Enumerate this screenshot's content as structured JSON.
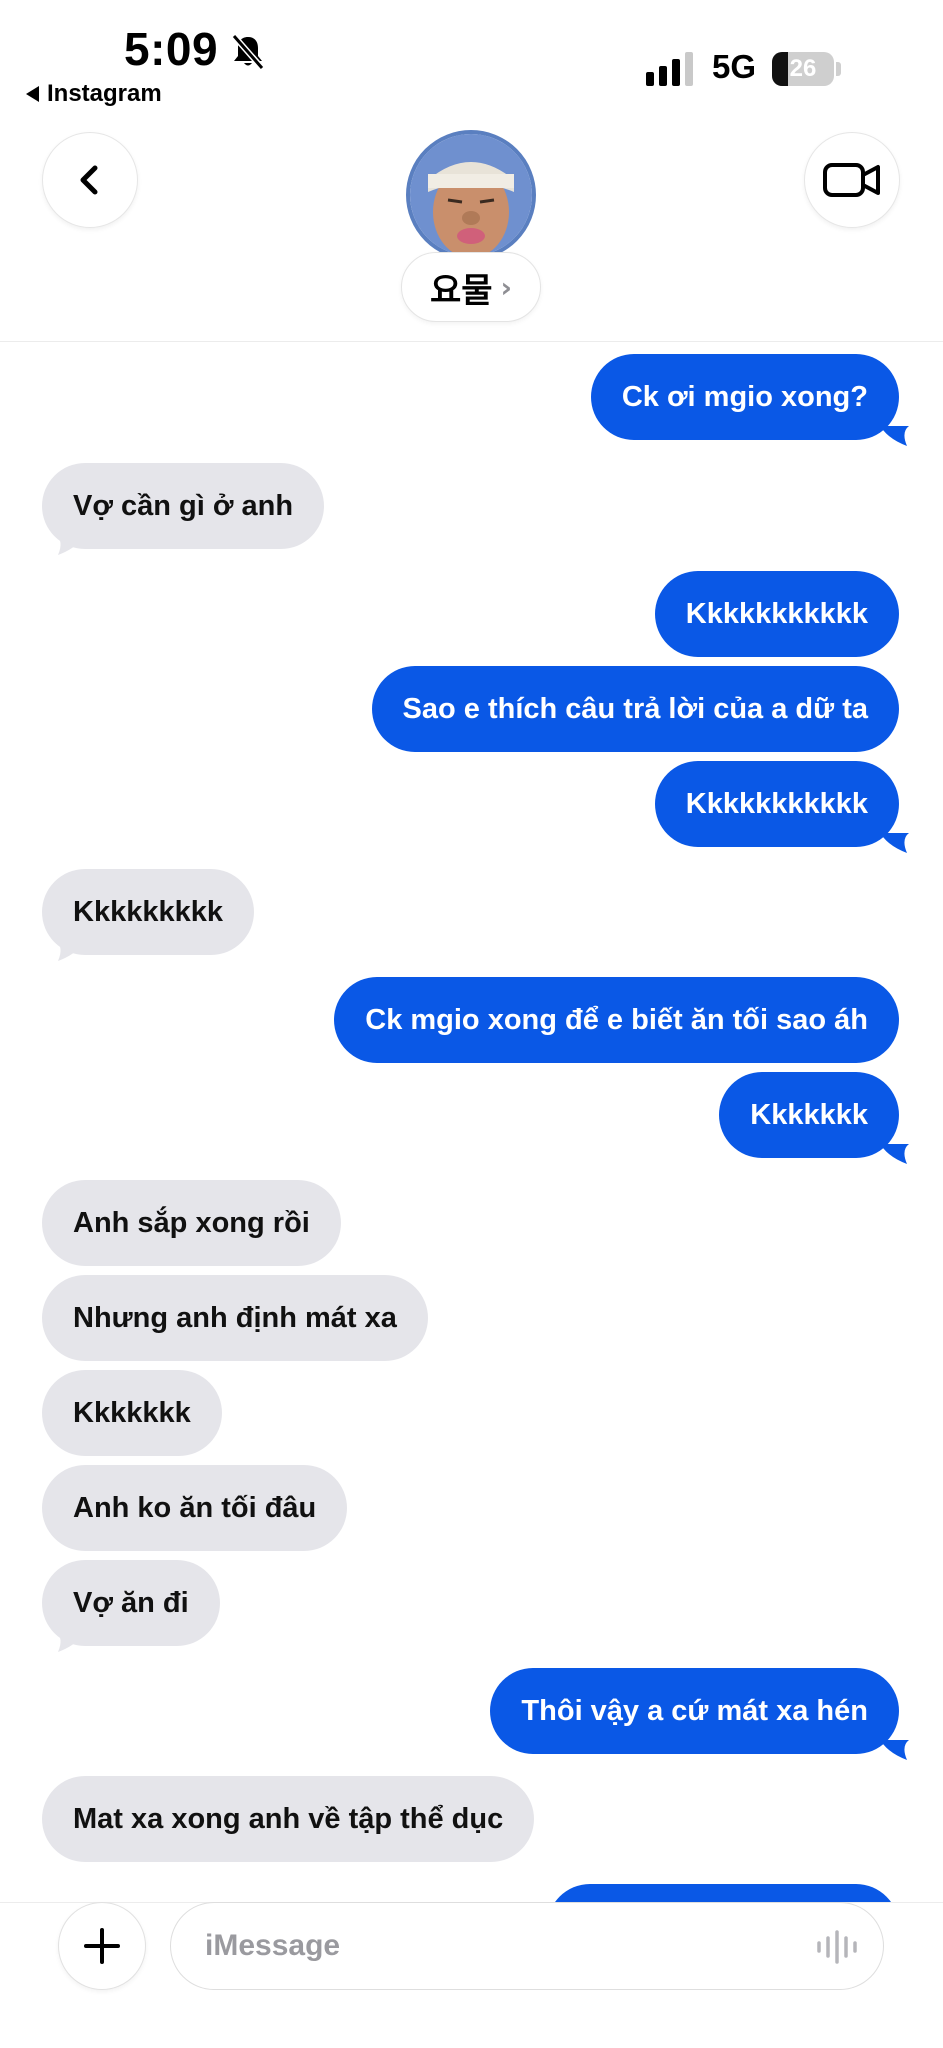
{
  "status_bar": {
    "time": "5:09",
    "back_app": "Instagram",
    "network": "5G",
    "battery_level": "26",
    "battery_fraction": 0.26,
    "signal_bars_filled": 3
  },
  "header": {
    "contact_name": "요물",
    "chevron": "›"
  },
  "messages": [
    {
      "side": "out",
      "text": "Ck ơi mgio xong?",
      "tail": true
    },
    {
      "side": "in",
      "text": "Vợ cần gì ở anh",
      "tail": true
    },
    {
      "side": "out",
      "text": "Kkkkkkkkkkk",
      "tail": false
    },
    {
      "side": "out",
      "text": "Sao e thích câu trả lời của a dữ ta",
      "tail": false
    },
    {
      "side": "out",
      "text": "Kkkkkkkkkkk",
      "tail": true
    },
    {
      "side": "in",
      "text": "Kkkkkkkkk",
      "tail": true
    },
    {
      "side": "out",
      "text": "Ck mgio xong để e biết ăn tối sao áh",
      "tail": false
    },
    {
      "side": "out",
      "text": "Kkkkkkk",
      "tail": true
    },
    {
      "side": "in",
      "text": "Anh sắp xong rồi",
      "tail": false
    },
    {
      "side": "in",
      "text": "Nhưng anh định mát xa",
      "tail": false
    },
    {
      "side": "in",
      "text": "Kkkkkkk",
      "tail": false
    },
    {
      "side": "in",
      "text": "Anh ko ăn tối đâu",
      "tail": false
    },
    {
      "side": "in",
      "text": "Vợ ăn đi",
      "tail": true
    },
    {
      "side": "out",
      "text": "Thôi vậy a cứ mát xa hén",
      "tail": true
    },
    {
      "side": "in",
      "text": "Mat xa xong anh về tập thể dục",
      "tail": false
    },
    {
      "side": "out",
      "text": "",
      "tail": false
    }
  ],
  "composer": {
    "placeholder": "iMessage"
  },
  "icons": [
    "bell-slash-icon",
    "back-chevron-icon",
    "video-camera-icon",
    "plus-icon",
    "audio-wave-icon"
  ],
  "colors": {
    "outgoing_bubble": "#0a58e6",
    "incoming_bubble": "#e5e5ea"
  }
}
